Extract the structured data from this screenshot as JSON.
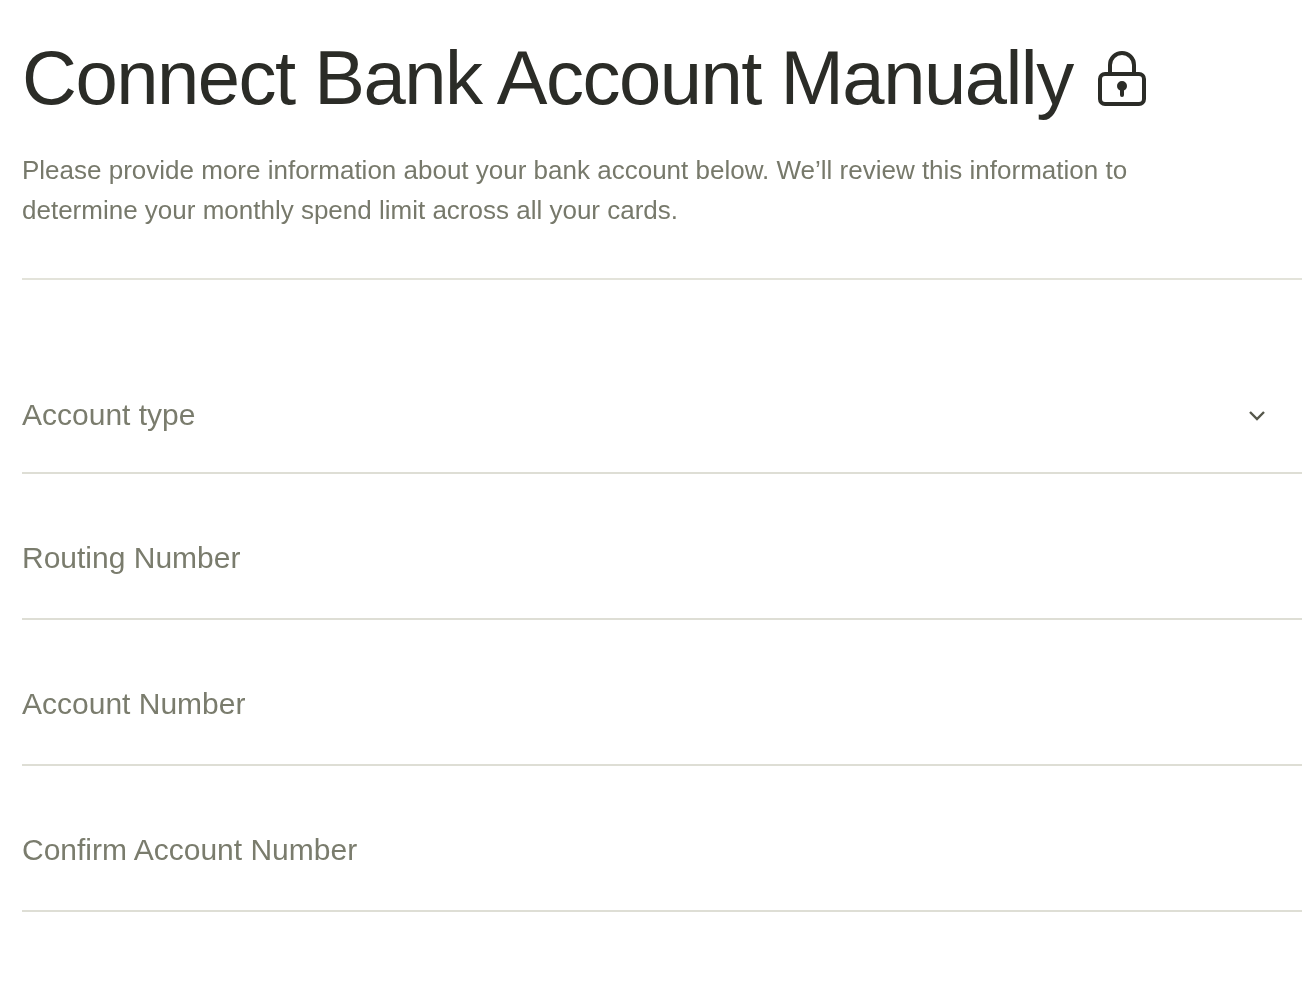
{
  "title": "Connect Bank Account Manually",
  "description": "Please provide more information about your bank account below. We’ll review this information to determine your monthly spend limit across all your cards.",
  "fields": [
    {
      "kind": "select",
      "placeholder": "Account type"
    },
    {
      "kind": "text",
      "placeholder": "Routing Number"
    },
    {
      "kind": "text",
      "placeholder": "Account Number"
    },
    {
      "kind": "text",
      "placeholder": "Confirm Account Number"
    }
  ]
}
